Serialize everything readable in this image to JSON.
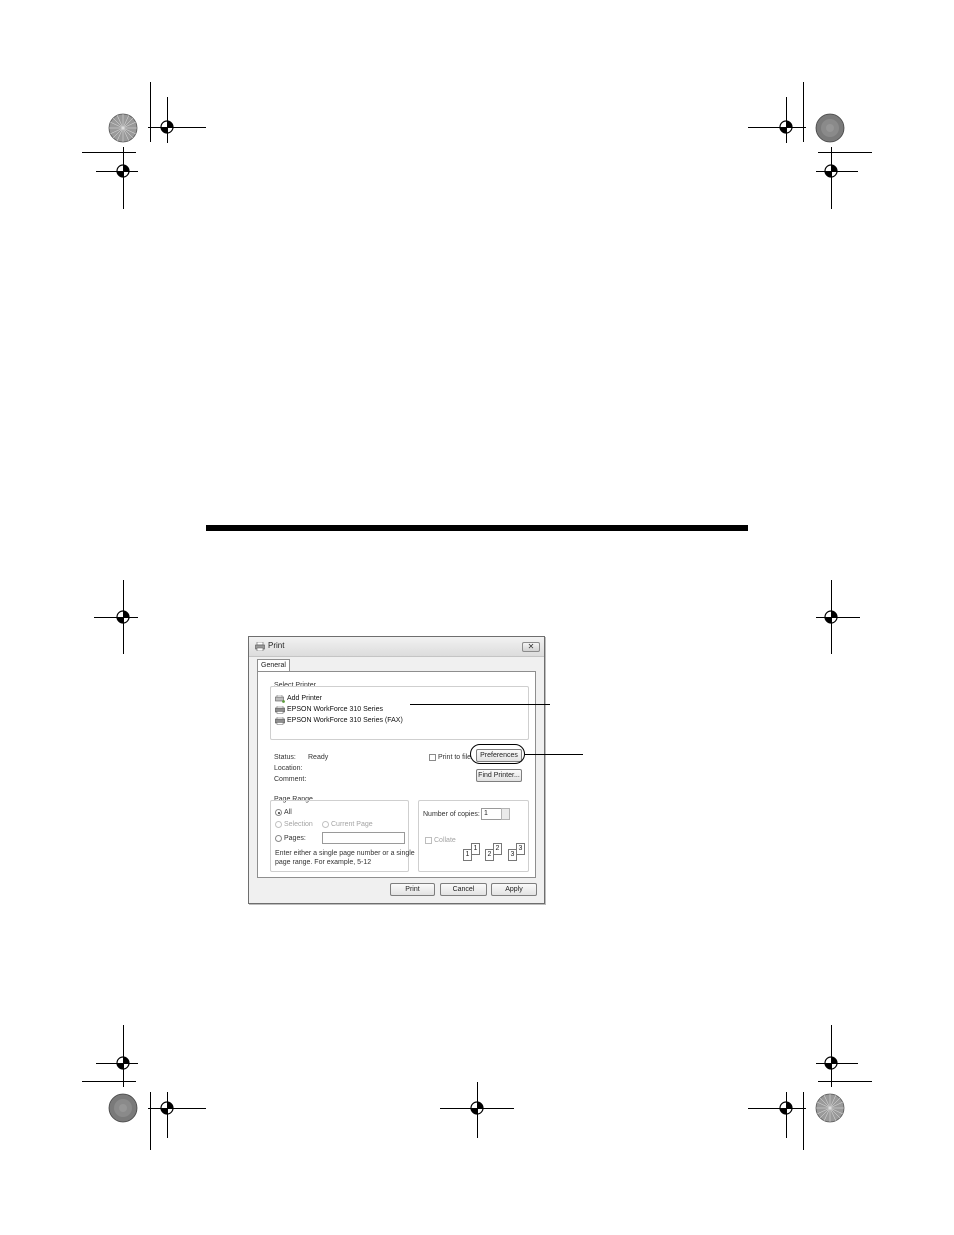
{
  "dialog": {
    "title": "Print",
    "close_glyph": "✕",
    "tab": "General",
    "select_printer": {
      "label": "Select Printer",
      "printers": [
        "Add Printer",
        "EPSON WorkForce 310 Series",
        "EPSON WorkForce 310 Series (FAX)"
      ]
    },
    "status": {
      "label": "Status:",
      "value": "Ready"
    },
    "location": {
      "label": "Location:"
    },
    "comment": {
      "label": "Comment:"
    },
    "print_to_file": "Print to file",
    "preferences_button": "Preferences",
    "find_printer_button": "Find Printer...",
    "page_range": {
      "label": "Page Range",
      "all": "All",
      "selection": "Selection",
      "current_page": "Current Page",
      "pages": "Pages:",
      "hint_line1": "Enter either a single page number or a single",
      "hint_line2": "page range.  For example, 5-12"
    },
    "copies": {
      "label": "Number of copies:",
      "value": "1",
      "collate": "Collate",
      "page_numbers": [
        "1",
        "1",
        "2",
        "2",
        "3",
        "3"
      ]
    },
    "buttons": {
      "print": "Print",
      "cancel": "Cancel",
      "apply": "Apply"
    }
  }
}
